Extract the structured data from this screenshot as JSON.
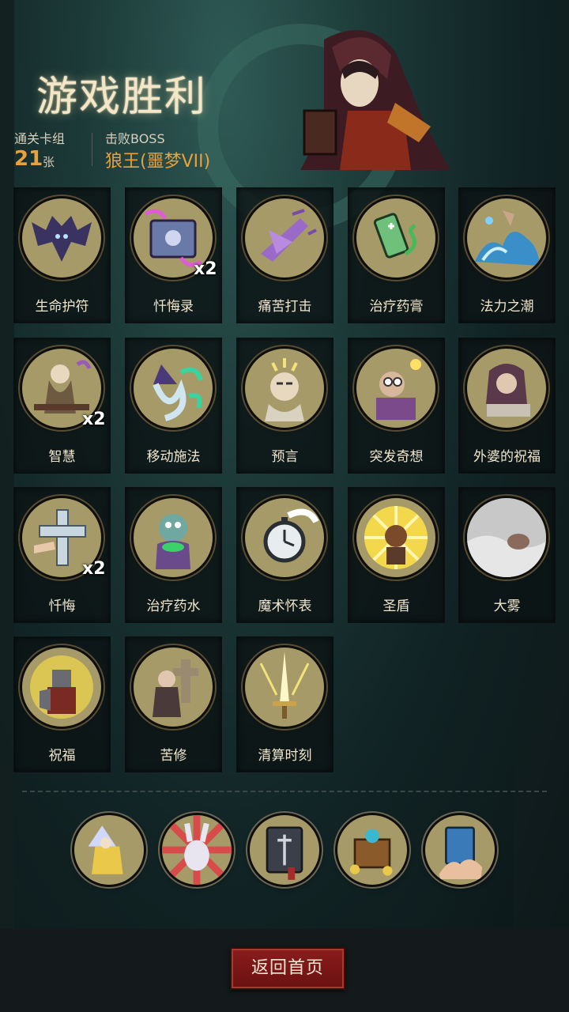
{
  "header": {
    "title": "游戏胜利",
    "deck_label": "通关卡组",
    "deck_count": "21",
    "deck_unit": "张",
    "boss_label": "击败BOSS",
    "boss_name": "狼王(噩梦VII)"
  },
  "cards": [
    {
      "name": "生命护符",
      "icon": "bat-icon",
      "count": ""
    },
    {
      "name": "忏悔录",
      "icon": "book-icon",
      "count": "x2"
    },
    {
      "name": "痛苦打击",
      "icon": "strike-icon",
      "count": ""
    },
    {
      "name": "治疗药膏",
      "icon": "ointment-icon",
      "count": ""
    },
    {
      "name": "法力之潮",
      "icon": "wave-icon",
      "count": ""
    },
    {
      "name": "智慧",
      "icon": "sage-icon",
      "count": "x2"
    },
    {
      "name": "移动施法",
      "icon": "wizard-icon",
      "count": ""
    },
    {
      "name": "预言",
      "icon": "prophet-icon",
      "count": ""
    },
    {
      "name": "突发奇想",
      "icon": "idea-icon",
      "count": ""
    },
    {
      "name": "外婆的祝福",
      "icon": "grandma-icon",
      "count": ""
    },
    {
      "name": "忏悔",
      "icon": "cross-icon",
      "count": "x2"
    },
    {
      "name": "治疗药水",
      "icon": "potion-icon",
      "count": ""
    },
    {
      "name": "魔术怀表",
      "icon": "pocket-watch-icon",
      "count": ""
    },
    {
      "name": "圣盾",
      "icon": "holy-shield-icon",
      "count": ""
    },
    {
      "name": "大雾",
      "icon": "fog-icon",
      "count": ""
    },
    {
      "name": "祝福",
      "icon": "knight-icon",
      "count": ""
    },
    {
      "name": "苦修",
      "icon": "ascetic-icon",
      "count": ""
    },
    {
      "name": "清算时刻",
      "icon": "sword-icon",
      "count": ""
    }
  ],
  "relics": [
    {
      "icon": "wizard-relic-icon"
    },
    {
      "icon": "rabbit-relic-icon"
    },
    {
      "icon": "tome-relic-icon"
    },
    {
      "icon": "treasure-relic-icon"
    },
    {
      "icon": "card-hand-relic-icon"
    }
  ],
  "footer": {
    "return_label": "返回首页"
  },
  "colors": {
    "accent_orange": "#e9a13b",
    "medal_bg": "#a59a68",
    "button_red": "#7a1616"
  }
}
